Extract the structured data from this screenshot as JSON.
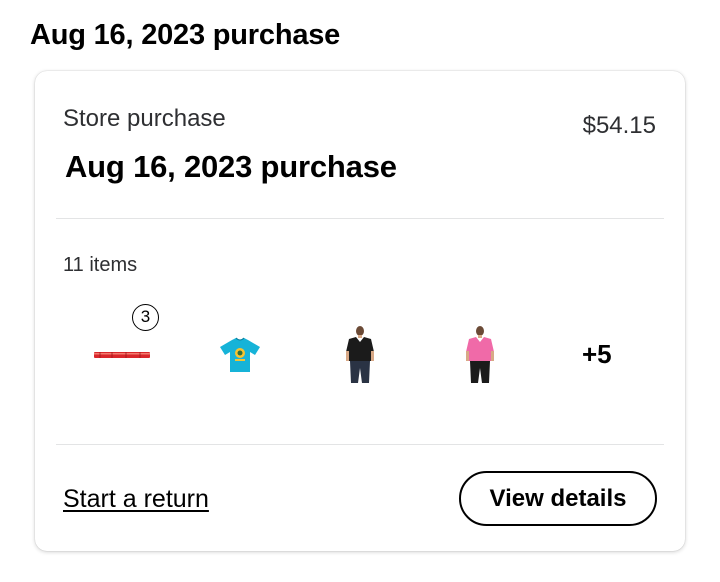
{
  "page": {
    "heading": "Aug 16, 2023 purchase"
  },
  "order": {
    "type": "Store purchase",
    "total": "$54.15",
    "title": "Aug 16, 2023 purchase",
    "items_count": "11 items",
    "items": [
      {
        "icon": "red-licorice-stick-icon",
        "quantity": "3",
        "color": "#d9262b"
      },
      {
        "icon": "blue-graphic-tshirt-icon",
        "color": "#16b3d8"
      },
      {
        "icon": "black-vneck-tshirt-icon",
        "color": "#1b1b1b"
      },
      {
        "icon": "pink-vneck-tshirt-icon",
        "color": "#f06aa8"
      }
    ],
    "more_items": "+5"
  },
  "actions": {
    "start_return": "Start a return",
    "view_details": "View details"
  }
}
